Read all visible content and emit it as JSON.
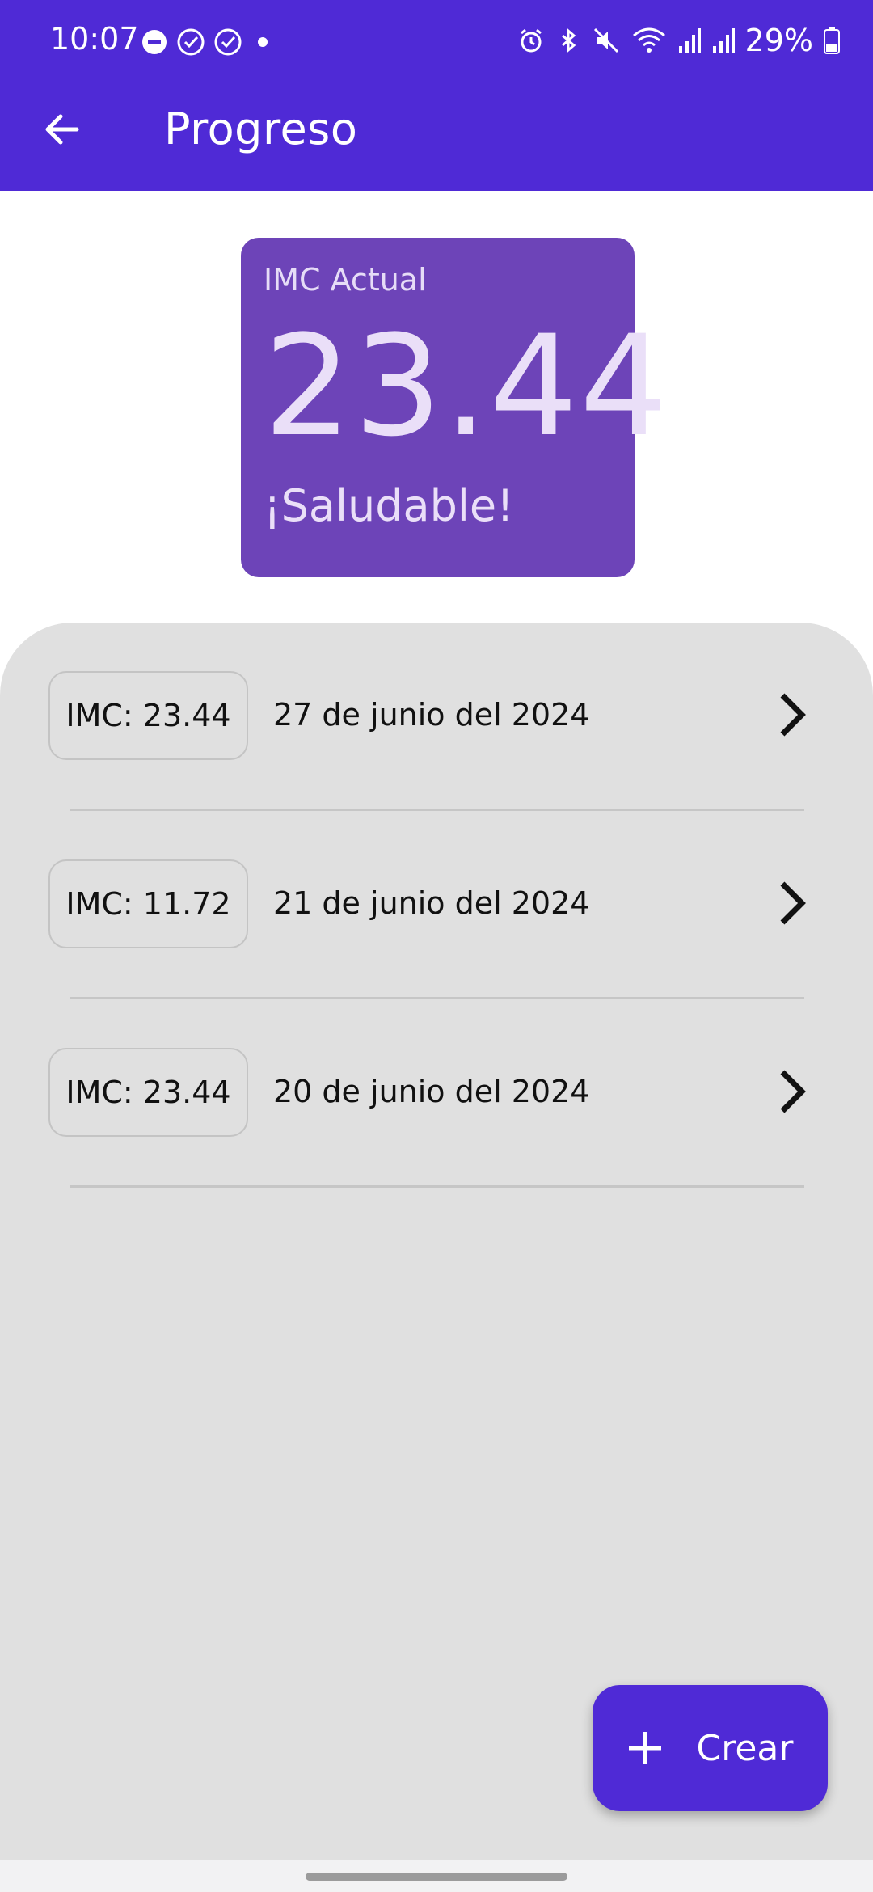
{
  "status_bar": {
    "time": "10:07",
    "battery": "29%",
    "left_icons": [
      "do-not-disturb-icon",
      "check-circle-icon",
      "check-circle-icon",
      "dot-icon"
    ],
    "right_icons": [
      "alarm-icon",
      "bluetooth-icon",
      "mute-icon",
      "wifi-icon",
      "signal-icon",
      "signal-icon",
      "battery-icon"
    ]
  },
  "app_bar": {
    "title": "Progreso",
    "back_icon": "arrow-back-icon"
  },
  "bmi_card": {
    "label": "IMC Actual",
    "value": "23.44",
    "status": "¡Saludable!"
  },
  "history": {
    "rows": [
      {
        "chip": "IMC: 23.44",
        "date": "27 de junio del 2024"
      },
      {
        "chip": "IMC: 11.72",
        "date": "21 de junio del 2024"
      },
      {
        "chip": "IMC: 23.44",
        "date": "20 de junio del 2024"
      }
    ]
  },
  "fab": {
    "label": "Crear",
    "icon": "plus-icon"
  },
  "colors": {
    "primary": "#4f2ad6",
    "card": "#6d44b8",
    "panel": "#e0e0e0"
  }
}
